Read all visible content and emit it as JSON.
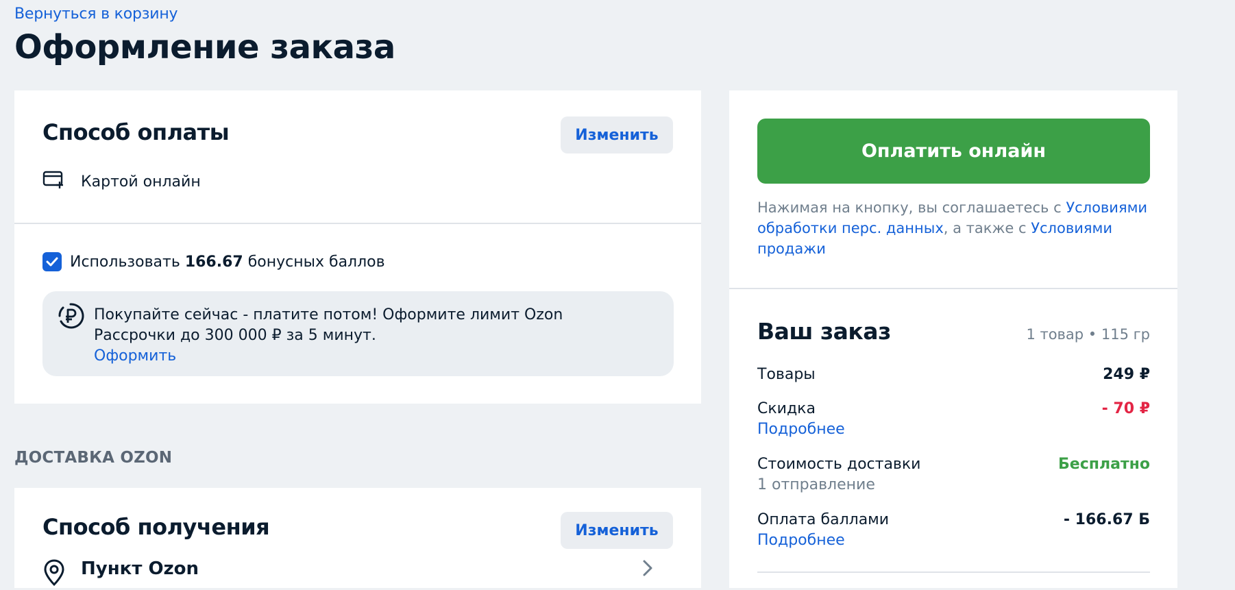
{
  "header": {
    "back_link": "Вернуться в корзину",
    "title": "Оформление заказа"
  },
  "payment": {
    "title": "Способ оплаты",
    "change_label": "Изменить",
    "method_label": "Картой онлайн",
    "bonus_prefix": "Использовать",
    "bonus_amount": "166.67",
    "bonus_suffix": "бонусных баллов",
    "bonus_checked": true,
    "promo_text": "Покупайте сейчас - платите потом! Оформите лимит Ozon Рассрочки до 300 000 ₽ за 5 минут.",
    "promo_link": "Оформить"
  },
  "delivery": {
    "section_label": "ДОСТАВКА OZON",
    "title": "Способ получения",
    "change_label": "Изменить",
    "pickup_title": "Пункт Ozon"
  },
  "summary": {
    "pay_button": "Оплатить онлайн",
    "terms_prefix": "Нажимая на кнопку, вы соглашаетесь с ",
    "terms_link1": "Условиями обработки перс. данных",
    "terms_middle": ", а также с ",
    "terms_link2": "Условиями продажи",
    "order_title": "Ваш заказ",
    "order_count": "1 товар • 115 гр",
    "rows": {
      "goods": {
        "label": "Товары",
        "value": "249 ₽"
      },
      "discount": {
        "label": "Скидка",
        "link": "Подробнее",
        "value": "- 70 ₽"
      },
      "shipping": {
        "label": "Стоимость доставки",
        "sub": "1 отправление",
        "value": "Бесплатно"
      },
      "points": {
        "label": "Оплата баллами",
        "link": "Подробнее",
        "value": "- 166.67 Б"
      }
    }
  },
  "colors": {
    "accent": "#1561d8",
    "pay_green": "#3ca047",
    "discount_red": "#e32545",
    "background": "#eef1f4"
  }
}
